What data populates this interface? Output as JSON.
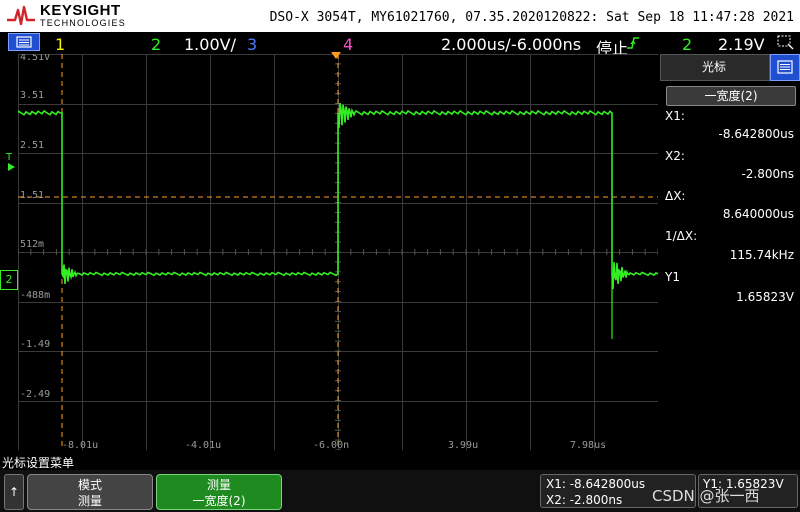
{
  "header": {
    "brand": "KEYSIGHT",
    "brand_sub": "TECHNOLOGIES",
    "instrument_info": "DSO-X 3054T, MY61021760, 07.35.2020120822: Sat Sep 18 11:47:28 2021"
  },
  "status": {
    "ch1": "1",
    "ch2": "2",
    "ch2_scale": "1.00V/",
    "ch3": "3",
    "ch4": "4",
    "timebase": "2.000us/",
    "delay": "-6.000ns",
    "run_state": "停止",
    "trigger_source": "2",
    "trigger_level": "2.19V"
  },
  "display": {
    "trigger_marker": "T",
    "ground_marker": "2",
    "y_ticks": [
      "4.51V",
      "3.51",
      "2.51",
      "1.51",
      "512m",
      "-488m",
      "-1.49",
      "-2.49"
    ],
    "x_ticks": [
      "-8.01u",
      "-4.01u",
      "-6.00n",
      "3.99u",
      "7.98us"
    ],
    "colors": {
      "trace": "#33ee22",
      "cursor": "#ff9d1a",
      "grid": "#3a3a3a",
      "menu_blue": "#1f4fd0"
    }
  },
  "cursor_panel": {
    "title": "光标",
    "mode_select": "一宽度(2)",
    "readouts": [
      {
        "label": "X1:",
        "value": "-8.642800us"
      },
      {
        "label": "X2:",
        "value": "-2.800ns"
      },
      {
        "label": "ΔX:",
        "value": "8.640000us"
      },
      {
        "label": "1/ΔX:",
        "value": "115.74kHz"
      },
      {
        "label": "Y1",
        "value": "1.65823V"
      }
    ]
  },
  "bottom": {
    "menu_title": "光标设置菜单",
    "up_label": "↑",
    "softkey_mode_line1": "模式",
    "softkey_mode_line2": "测量",
    "softkey_measure_line1": "测量",
    "softkey_measure_line2": "一宽度(2)",
    "summary_x1": "X1: -8.642800us",
    "summary_x2": "X2: -2.800ns",
    "summary_y1": "Y1: 1.65823V",
    "watermark": "CSDN @张一西"
  }
}
